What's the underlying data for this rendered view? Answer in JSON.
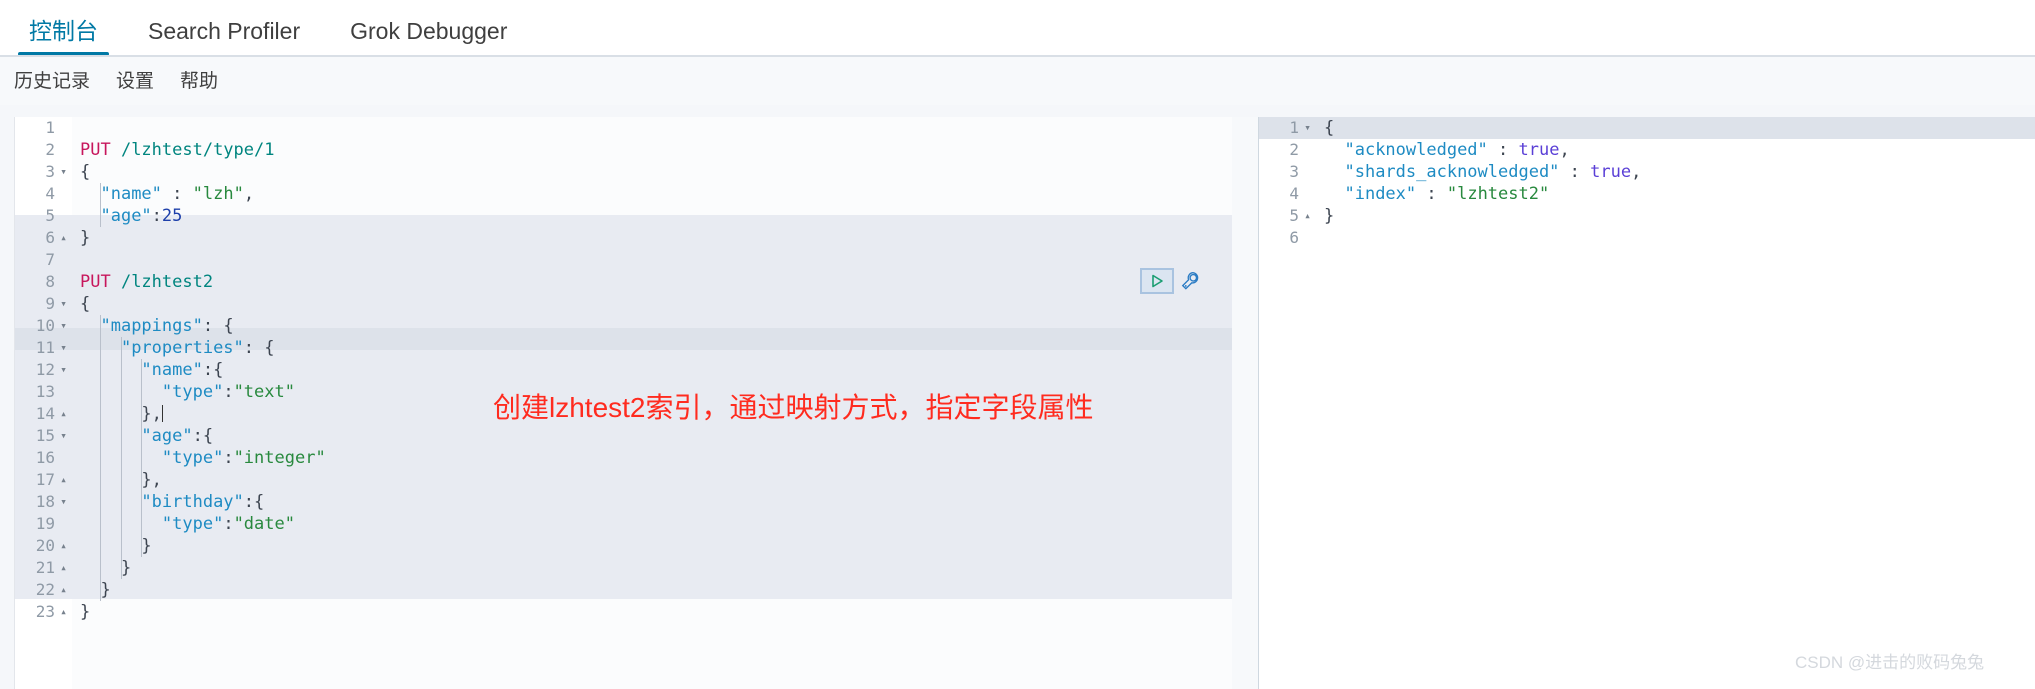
{
  "tabs": [
    {
      "label": "控制台",
      "active": true
    },
    {
      "label": "Search Profiler",
      "active": false
    },
    {
      "label": "Grok Debugger",
      "active": false
    }
  ],
  "subnav": [
    {
      "label": "历史记录"
    },
    {
      "label": "设置"
    },
    {
      "label": "帮助"
    }
  ],
  "editor": {
    "lines": [
      {
        "n": "1",
        "fold": "",
        "segments": []
      },
      {
        "n": "2",
        "fold": "",
        "segments": [
          {
            "t": "PUT ",
            "c": "k-method"
          },
          {
            "t": "/lzhtest/type/1",
            "c": "k-url"
          }
        ]
      },
      {
        "n": "3",
        "fold": "▾",
        "segments": [
          {
            "t": "{",
            "c": "k-punct"
          }
        ]
      },
      {
        "n": "4",
        "fold": "",
        "segments": [
          {
            "t": "  ",
            "c": ""
          },
          {
            "t": "\"name\"",
            "c": "k-key"
          },
          {
            "t": " : ",
            "c": "k-punct"
          },
          {
            "t": "\"lzh\"",
            "c": "k-str"
          },
          {
            "t": ",",
            "c": "k-punct"
          }
        ]
      },
      {
        "n": "5",
        "fold": "",
        "segments": [
          {
            "t": "  ",
            "c": ""
          },
          {
            "t": "\"age\"",
            "c": "k-key"
          },
          {
            "t": ":",
            "c": "k-punct"
          },
          {
            "t": "25",
            "c": "k-num"
          }
        ]
      },
      {
        "n": "6",
        "fold": "▴",
        "segments": [
          {
            "t": "}",
            "c": "k-punct"
          }
        ]
      },
      {
        "n": "7",
        "fold": "",
        "segments": []
      },
      {
        "n": "8",
        "fold": "",
        "segments": [
          {
            "t": "PUT ",
            "c": "k-method"
          },
          {
            "t": "/lzhtest2",
            "c": "k-url"
          }
        ]
      },
      {
        "n": "9",
        "fold": "▾",
        "segments": [
          {
            "t": "{",
            "c": "k-punct"
          }
        ]
      },
      {
        "n": "10",
        "fold": "▾",
        "segments": [
          {
            "t": "  ",
            "c": ""
          },
          {
            "t": "\"mappings\"",
            "c": "k-key"
          },
          {
            "t": ": {",
            "c": "k-punct"
          }
        ]
      },
      {
        "n": "11",
        "fold": "▾",
        "segments": [
          {
            "t": "    ",
            "c": ""
          },
          {
            "t": "\"properties\"",
            "c": "k-key"
          },
          {
            "t": ": {",
            "c": "k-punct"
          }
        ]
      },
      {
        "n": "12",
        "fold": "▾",
        "segments": [
          {
            "t": "      ",
            "c": ""
          },
          {
            "t": "\"name\"",
            "c": "k-key"
          },
          {
            "t": ":{",
            "c": "k-punct"
          }
        ]
      },
      {
        "n": "13",
        "fold": "",
        "segments": [
          {
            "t": "        ",
            "c": ""
          },
          {
            "t": "\"type\"",
            "c": "k-key"
          },
          {
            "t": ":",
            "c": "k-punct"
          },
          {
            "t": "\"text\"",
            "c": "k-str"
          }
        ]
      },
      {
        "n": "14",
        "fold": "▴",
        "segments": [
          {
            "t": "      ",
            "c": ""
          },
          {
            "t": "},",
            "c": "k-punct"
          }
        ],
        "cursor": true
      },
      {
        "n": "15",
        "fold": "▾",
        "segments": [
          {
            "t": "      ",
            "c": ""
          },
          {
            "t": "\"age\"",
            "c": "k-key"
          },
          {
            "t": ":{",
            "c": "k-punct"
          }
        ]
      },
      {
        "n": "16",
        "fold": "",
        "segments": [
          {
            "t": "        ",
            "c": ""
          },
          {
            "t": "\"type\"",
            "c": "k-key"
          },
          {
            "t": ":",
            "c": "k-punct"
          },
          {
            "t": "\"integer\"",
            "c": "k-str"
          }
        ]
      },
      {
        "n": "17",
        "fold": "▴",
        "segments": [
          {
            "t": "      ",
            "c": ""
          },
          {
            "t": "},",
            "c": "k-punct"
          }
        ]
      },
      {
        "n": "18",
        "fold": "▾",
        "segments": [
          {
            "t": "      ",
            "c": ""
          },
          {
            "t": "\"birthday\"",
            "c": "k-key"
          },
          {
            "t": ":{",
            "c": "k-punct"
          }
        ]
      },
      {
        "n": "19",
        "fold": "",
        "segments": [
          {
            "t": "        ",
            "c": ""
          },
          {
            "t": "\"type\"",
            "c": "k-key"
          },
          {
            "t": ":",
            "c": "k-punct"
          },
          {
            "t": "\"date\"",
            "c": "k-str"
          }
        ]
      },
      {
        "n": "20",
        "fold": "▴",
        "segments": [
          {
            "t": "      ",
            "c": ""
          },
          {
            "t": "}",
            "c": "k-punct"
          }
        ]
      },
      {
        "n": "21",
        "fold": "▴",
        "segments": [
          {
            "t": "    ",
            "c": ""
          },
          {
            "t": "}",
            "c": "k-punct"
          }
        ]
      },
      {
        "n": "22",
        "fold": "▴",
        "segments": [
          {
            "t": "  ",
            "c": ""
          },
          {
            "t": "}",
            "c": "k-punct"
          }
        ]
      },
      {
        "n": "23",
        "fold": "▴",
        "segments": [
          {
            "t": "}",
            "c": "k-punct"
          }
        ]
      }
    ]
  },
  "actions": {
    "play_title": "发送请求",
    "play_icon": "play-triangle-icon",
    "wrench_title": "操作菜单",
    "wrench_icon": "wrench-icon"
  },
  "response": {
    "lines": [
      {
        "n": "1",
        "fold": "▾",
        "segments": [
          {
            "t": "{",
            "c": "k-punct"
          }
        ]
      },
      {
        "n": "2",
        "fold": "",
        "segments": [
          {
            "t": "  ",
            "c": ""
          },
          {
            "t": "\"acknowledged\"",
            "c": "k-key"
          },
          {
            "t": " : ",
            "c": "k-punct"
          },
          {
            "t": "true",
            "c": "k-bool"
          },
          {
            "t": ",",
            "c": "k-punct"
          }
        ]
      },
      {
        "n": "3",
        "fold": "",
        "segments": [
          {
            "t": "  ",
            "c": ""
          },
          {
            "t": "\"shards_acknowledged\"",
            "c": "k-key"
          },
          {
            "t": " : ",
            "c": "k-punct"
          },
          {
            "t": "true",
            "c": "k-bool"
          },
          {
            "t": ",",
            "c": "k-punct"
          }
        ]
      },
      {
        "n": "4",
        "fold": "",
        "segments": [
          {
            "t": "  ",
            "c": ""
          },
          {
            "t": "\"index\"",
            "c": "k-key"
          },
          {
            "t": " : ",
            "c": "k-punct"
          },
          {
            "t": "\"lzhtest2\"",
            "c": "k-str"
          }
        ]
      },
      {
        "n": "5",
        "fold": "▴",
        "segments": [
          {
            "t": "}",
            "c": "k-punct"
          }
        ]
      },
      {
        "n": "6",
        "fold": "",
        "segments": []
      }
    ]
  },
  "annotation": {
    "text": "创建lzhtest2索引，通过映射方式，指定字段属性",
    "color": "#ff2b1f"
  },
  "watermark": {
    "text": "CSDN @进击的败码兔兔"
  },
  "colors": {
    "accent": "#0079a5",
    "selected_band": "#e8ebf2",
    "active_line": "#dde2ea",
    "method": "#c7165c",
    "url": "#00857f",
    "key": "#1e8bc3",
    "string": "#28893e",
    "number": "#1d3faa",
    "boolean": "#5a3fd6"
  }
}
